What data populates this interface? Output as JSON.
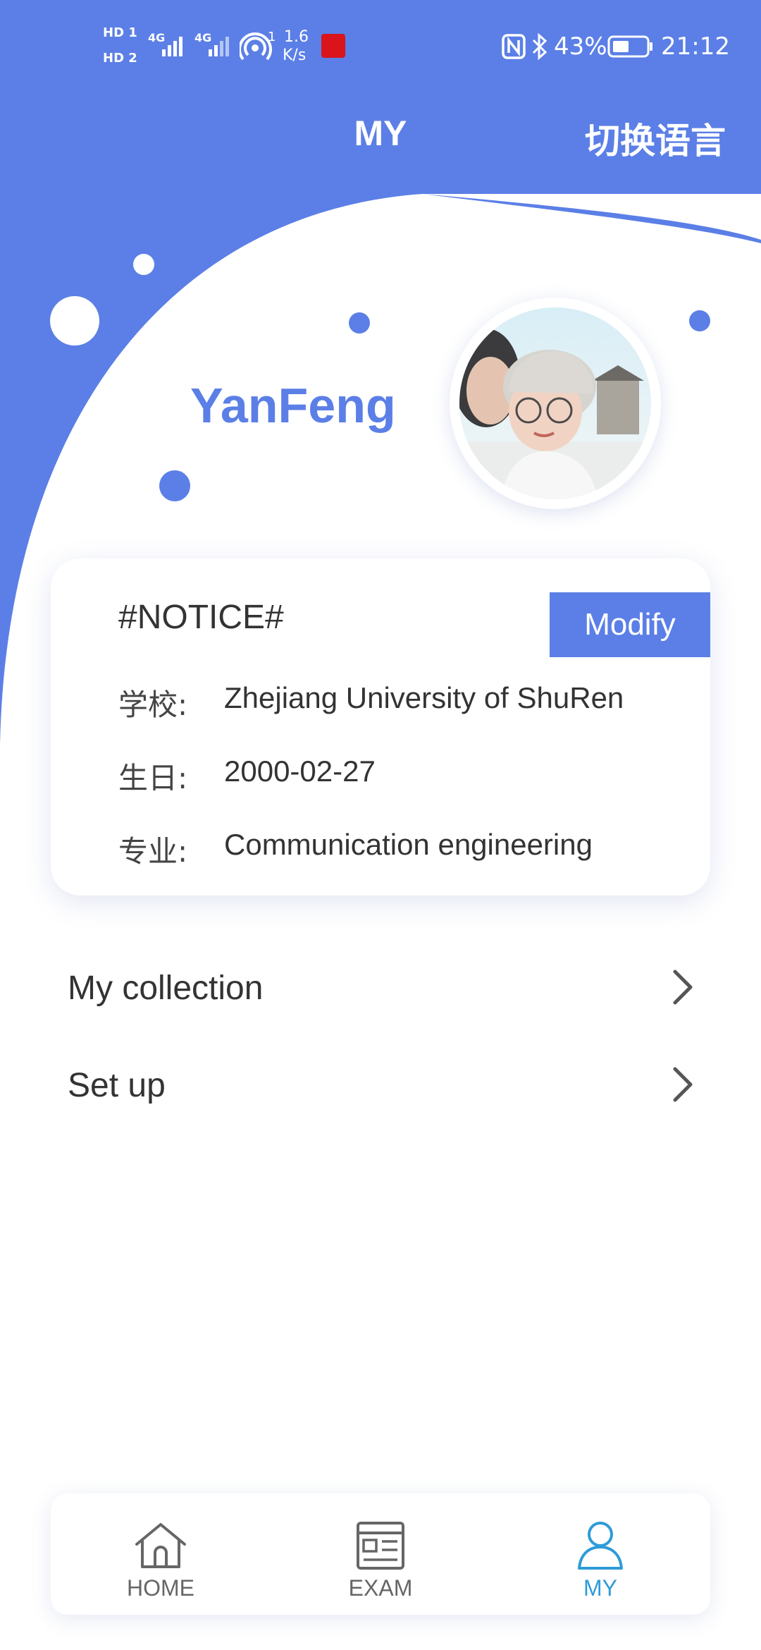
{
  "status_bar": {
    "time": "21:12",
    "battery": "43%",
    "network_speed_value": "1.6",
    "network_speed_unit": "K/s",
    "sim1_tag": "HD 1",
    "sim2_tag": "HD 2",
    "net1": "4G",
    "net2": "4G",
    "hotspot_count": "1"
  },
  "header": {
    "title": "MY",
    "language_switch": "切换语言"
  },
  "profile": {
    "username": "YanFeng"
  },
  "notice_card": {
    "title": "#NOTICE#",
    "modify_label": "Modify",
    "school_label": "学校:",
    "school_value": "Zhejiang University of ShuRen",
    "birthday_label": "生日:",
    "birthday_value": "2000-02-27",
    "major_label": "专业:",
    "major_value": "Communication engineering"
  },
  "menu": {
    "items": [
      {
        "label": "My collection",
        "icon": "chevron-right-icon"
      },
      {
        "label": "Set up",
        "icon": "chevron-right-icon"
      }
    ]
  },
  "bottom_nav": {
    "items": [
      {
        "label": "HOME",
        "icon": "home-icon",
        "active": false
      },
      {
        "label": "EXAM",
        "icon": "exam-icon",
        "active": false
      },
      {
        "label": "MY",
        "icon": "user-icon",
        "active": true
      }
    ]
  },
  "colors": {
    "primary": "#5b7fe6",
    "nav_active": "#2f9bd8",
    "nav_inactive": "#666666",
    "text": "#333333"
  }
}
